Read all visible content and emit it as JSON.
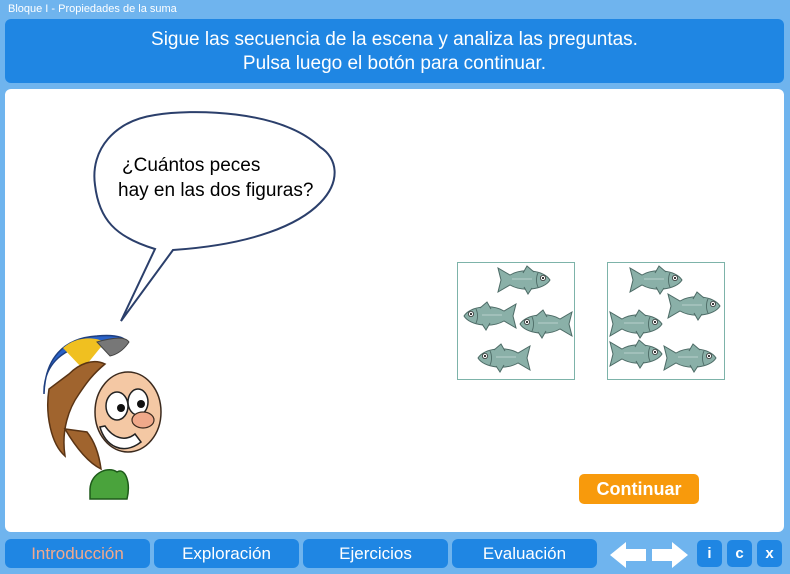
{
  "window": {
    "title": "Bloque I - Propiedades de la suma"
  },
  "instructions": {
    "line1": "Sigue las secuencia de la escena y analiza las preguntas.",
    "line2": "Pulsa luego el botón para continuar."
  },
  "speech": {
    "line1": "¿Cuántos peces",
    "line2": "hay en las dos figuras?"
  },
  "figures": [
    {
      "fish_count": 4
    },
    {
      "fish_count": 5
    }
  ],
  "continue_label": "Continuar",
  "nav": {
    "tabs": [
      {
        "label": "Introducción",
        "active": true
      },
      {
        "label": "Exploración",
        "active": false
      },
      {
        "label": "Ejercicios",
        "active": false
      },
      {
        "label": "Evaluación",
        "active": false
      }
    ],
    "buttons": {
      "info": "i",
      "credits": "c",
      "close": "x"
    }
  },
  "icons": {
    "back": "arrow-left-icon",
    "forward": "arrow-right-icon",
    "fish": "fish-icon",
    "character": "boy-with-cap-icon"
  },
  "colors": {
    "background": "#6fb4ee",
    "panel": "#1f86e3",
    "active_tab_text": "#f3a98c",
    "continue_button": "#f89a0c",
    "fish": "#8ab0a8"
  }
}
